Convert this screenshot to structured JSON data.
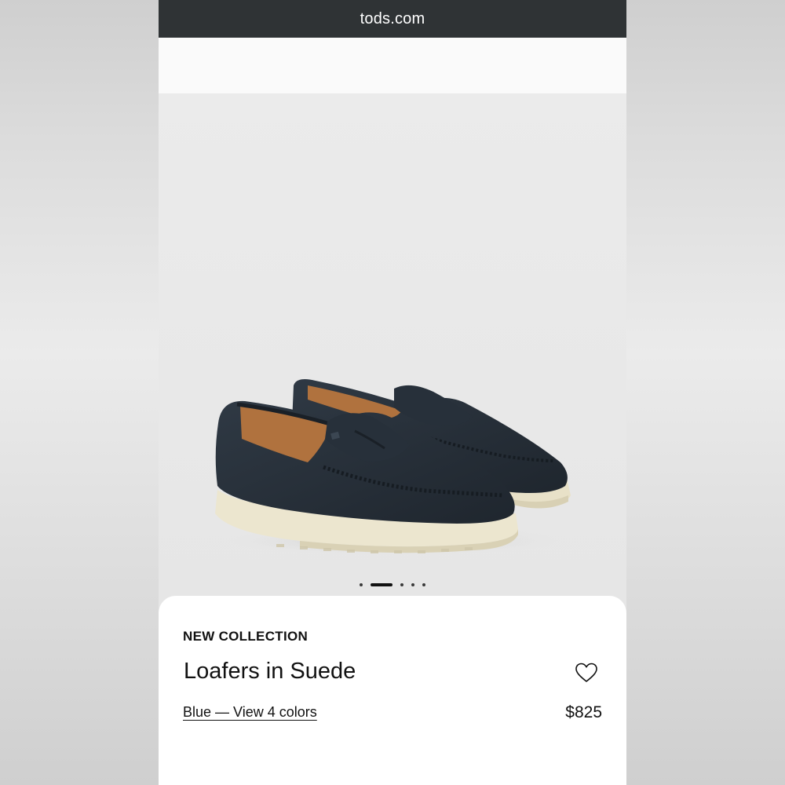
{
  "browser": {
    "url": "tods.com"
  },
  "carousel": {
    "image_alt": "Blue suede penny loafers with cream rubber sole",
    "dots_count": 5,
    "active_index": 1
  },
  "product": {
    "eyebrow": "NEW COLLECTION",
    "name": "Loafers in Suede",
    "colors_link": "Blue — View 4 colors",
    "price": "$825"
  },
  "icons": {
    "wishlist": "heart-outline-icon"
  },
  "colors": {
    "url_bar_bg": "#2f3335",
    "shoe_suede": "#28313a",
    "sole": "#ece6cf",
    "lining": "#b0723e"
  }
}
